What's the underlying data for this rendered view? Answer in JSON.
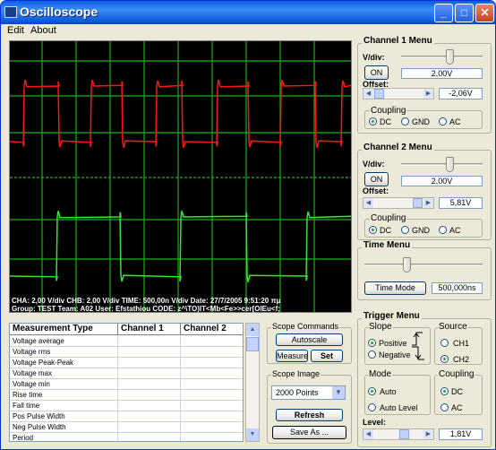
{
  "window": {
    "title": "Oscilloscope"
  },
  "menu": {
    "edit": "Edit",
    "about": "About"
  },
  "scope": {
    "status_line1": "CHA: 2,00 V/div    CHB: 2,00 V/div    TIME: 500,00n V/div    Date: 27/7/2005 9:51:20 πμ",
    "status_line2": "Group: TEST    Team: A02    User: Efstathiou    CODE: z^\\TO)IT<Mb<Fe>>cer[OIEu<f;",
    "colors": {
      "background": "#000000",
      "grid": "#17b317",
      "channel_a": "#ff1515",
      "channel_b": "#2fe82f"
    }
  },
  "ch1": {
    "title": "Channel 1 Menu",
    "vdiv_label": "V/div:",
    "on_label": "ON",
    "vdiv_value": "2,00V",
    "offset_label": "Offset:",
    "offset_value": "-2,06V",
    "coupling_label": "Coupling",
    "coupling_options": [
      "DC",
      "GND",
      "AC"
    ],
    "coupling_selected": "DC"
  },
  "ch2": {
    "title": "Channel 2 Menu",
    "vdiv_label": "V/div:",
    "on_label": "ON",
    "vdiv_value": "2,00V",
    "offset_label": "Offset:",
    "offset_value": "5,81V",
    "coupling_label": "Coupling",
    "coupling_options": [
      "DC",
      "GND",
      "AC"
    ],
    "coupling_selected": "DC"
  },
  "time": {
    "title": "Time Menu",
    "mode_label": "Time Mode",
    "value": "500,000ns"
  },
  "trigger": {
    "title": "Trigger Menu",
    "slope_label": "Slope",
    "slope_options": [
      "Positive",
      "Negative"
    ],
    "slope_selected": "Positive",
    "source_label": "Source",
    "source_options": [
      "CH1",
      "CH2"
    ],
    "source_selected": "CH2",
    "mode_label": "Mode",
    "mode_options": [
      "Auto",
      "Auto Level"
    ],
    "mode_selected": "Auto",
    "coupling_label": "Coupling",
    "coupling_options": [
      "DC",
      "AC"
    ],
    "coupling_selected": "DC",
    "level_label": "Level:",
    "level_value": "1,81V"
  },
  "measurements": {
    "headers": [
      "Measurement Type",
      "Channel 1",
      "Channel 2"
    ],
    "rows": [
      "Voltage average",
      "Voltage rms",
      "Voltage Peak-Peak",
      "Voltage max",
      "Voltage min",
      "Rise time",
      "Fall time",
      "Pos Pulse Width",
      "Neg Pulse Width",
      "Period"
    ]
  },
  "commands": {
    "title": "Scope Commands",
    "autoscale": "Autoscale",
    "measure": "Measure",
    "set": "Set"
  },
  "image": {
    "title": "Scope Image",
    "points_selected": "2000  Points",
    "refresh": "Refresh",
    "save_as": "Save As ..."
  }
}
